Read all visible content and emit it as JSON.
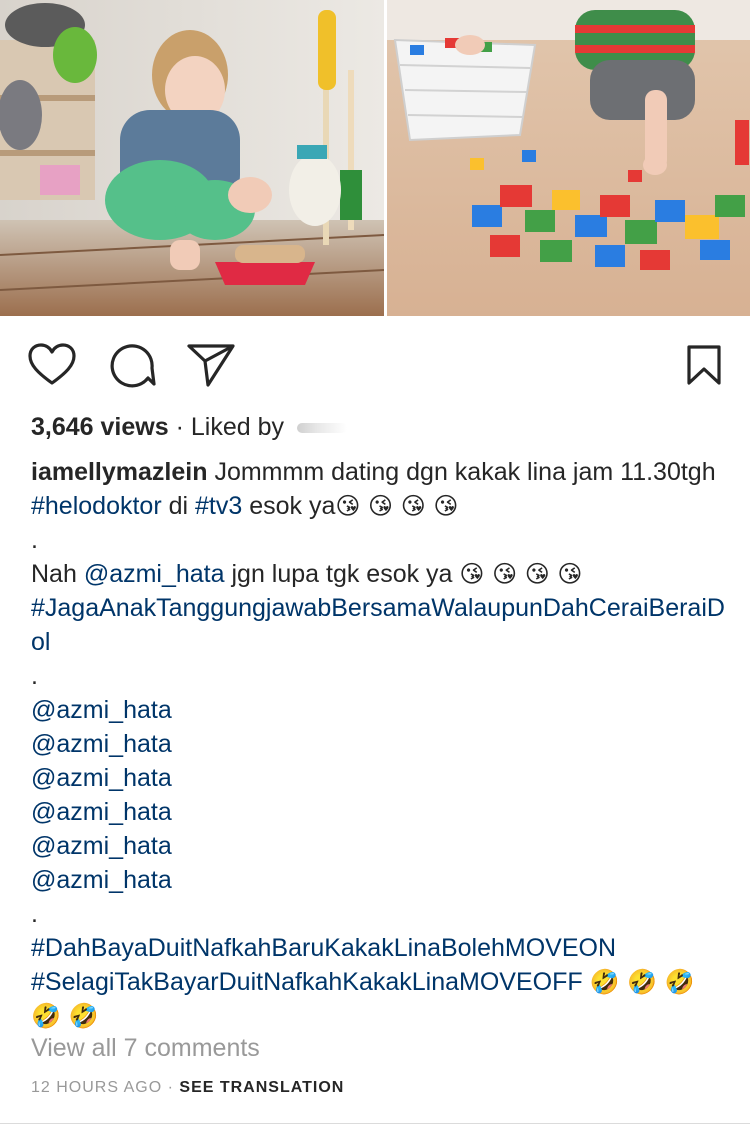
{
  "post": {
    "views_count": "3,646 views",
    "liked_by_prefix": "Liked by",
    "username": "iamellymazlein",
    "caption_lines": [
      [
        "Jommmm dating dgn kakak lina jam 11.30tgh ",
        "#helodoktor",
        " di ",
        "#tv3",
        " esok ya",
        "😘 😘 😘 😘"
      ],
      [
        "."
      ],
      [
        "Nah ",
        "@azmi_hata",
        " jgn lupa tgk esok ya ",
        "😘 😘 😘 😘"
      ],
      [
        "#JagaAnakTanggungjawabBersamaWalaupunDahCeraiBeraiDol"
      ],
      [
        "."
      ],
      [
        "@azmi_hata"
      ],
      [
        "@azmi_hata"
      ],
      [
        "@azmi_hata"
      ],
      [
        "@azmi_hata"
      ],
      [
        "@azmi_hata"
      ],
      [
        "@azmi_hata"
      ],
      [
        "."
      ],
      [
        "#DahBayaDuitNafkahBaruKakakLinaBolehMOVEON"
      ],
      [
        "#SelagiTakBayarDuitNafkahKakakLinaMOVEOFF",
        "🤣 🤣 🤣 🤣 🤣"
      ]
    ],
    "view_comments": "View all 7 comments",
    "time_ago": "12 HOURS AGO",
    "separator": "·",
    "see_translation": "SEE TRANSLATION"
  },
  "icons": {
    "like": "heart-icon",
    "comment": "comment-bubble-icon",
    "share": "paper-plane-icon",
    "save": "bookmark-icon"
  },
  "colors": {
    "text": "#262626",
    "link": "#003569",
    "muted": "#999999"
  }
}
